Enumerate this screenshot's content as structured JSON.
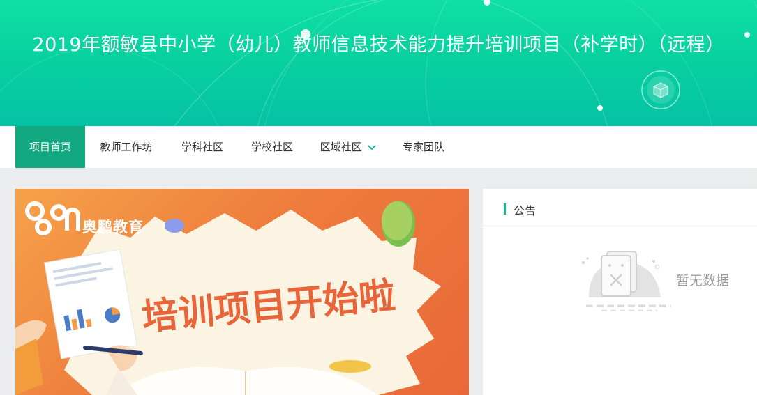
{
  "banner": {
    "title": "2019年额敏县中小学（幼儿）教师信息技术能力提升培训项目（补学时）（远程）"
  },
  "nav": {
    "items": [
      {
        "label": "项目首页",
        "active": true
      },
      {
        "label": "教师工作坊"
      },
      {
        "label": "学科社区"
      },
      {
        "label": "学校社区"
      },
      {
        "label": "区域社区",
        "has_dropdown": true
      },
      {
        "label": "专家团队"
      }
    ]
  },
  "promo": {
    "brand": "奥鹏教育",
    "logo_text": "Open",
    "headline": "培训项目开始啦"
  },
  "notice": {
    "title": "公告",
    "empty_text": "暂无数据"
  },
  "colors": {
    "accent": "#12a981",
    "banner_top": "#0fe0a4",
    "banner_bottom": "#05c2a4",
    "promo": "#ee7c3c",
    "headline": "#e8653a"
  }
}
